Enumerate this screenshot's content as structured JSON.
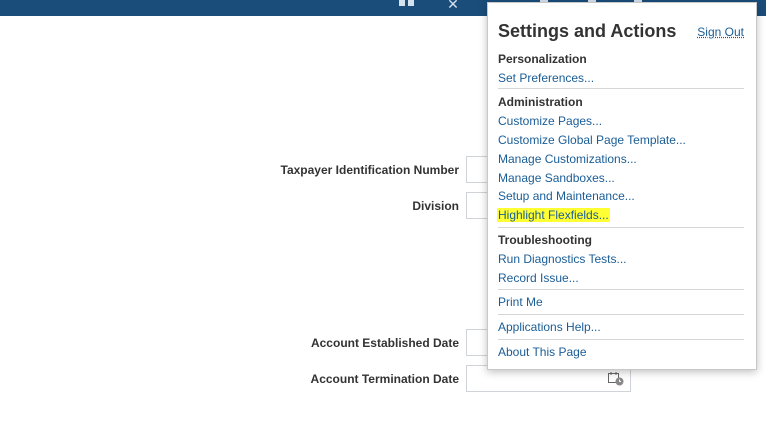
{
  "colors": {
    "topbar": "#1b4d7a",
    "link": "#1a5d96",
    "highlight": "#ffff33"
  },
  "topbar": {
    "icons": [
      "grid-icon",
      "star-icon",
      "menu-icon"
    ]
  },
  "form": {
    "taxpayer_label": "Taxpayer Identification Number",
    "division_label": "Division",
    "established_label": "Account Established Date",
    "termination_label": "Account Termination Date",
    "calendar_icon": "calendar-icon"
  },
  "settings_popup": {
    "title": "Settings and Actions",
    "sign_out": "Sign Out",
    "sections": {
      "personalization": "Personalization",
      "administration": "Administration",
      "troubleshooting": "Troubleshooting"
    },
    "items": {
      "set_preferences": "Set Preferences...",
      "customize_pages": "Customize Pages...",
      "customize_global": "Customize Global Page Template...",
      "manage_customizations": "Manage Customizations...",
      "manage_sandboxes": "Manage Sandboxes...",
      "setup_maintenance": "Setup and Maintenance...",
      "highlight_flexfields": "Highlight Flexfields...",
      "run_diagnostics": "Run Diagnostics Tests...",
      "record_issue": "Record Issue...",
      "print_me": "Print Me",
      "applications_help": "Applications Help...",
      "about_page": "About This Page"
    }
  }
}
